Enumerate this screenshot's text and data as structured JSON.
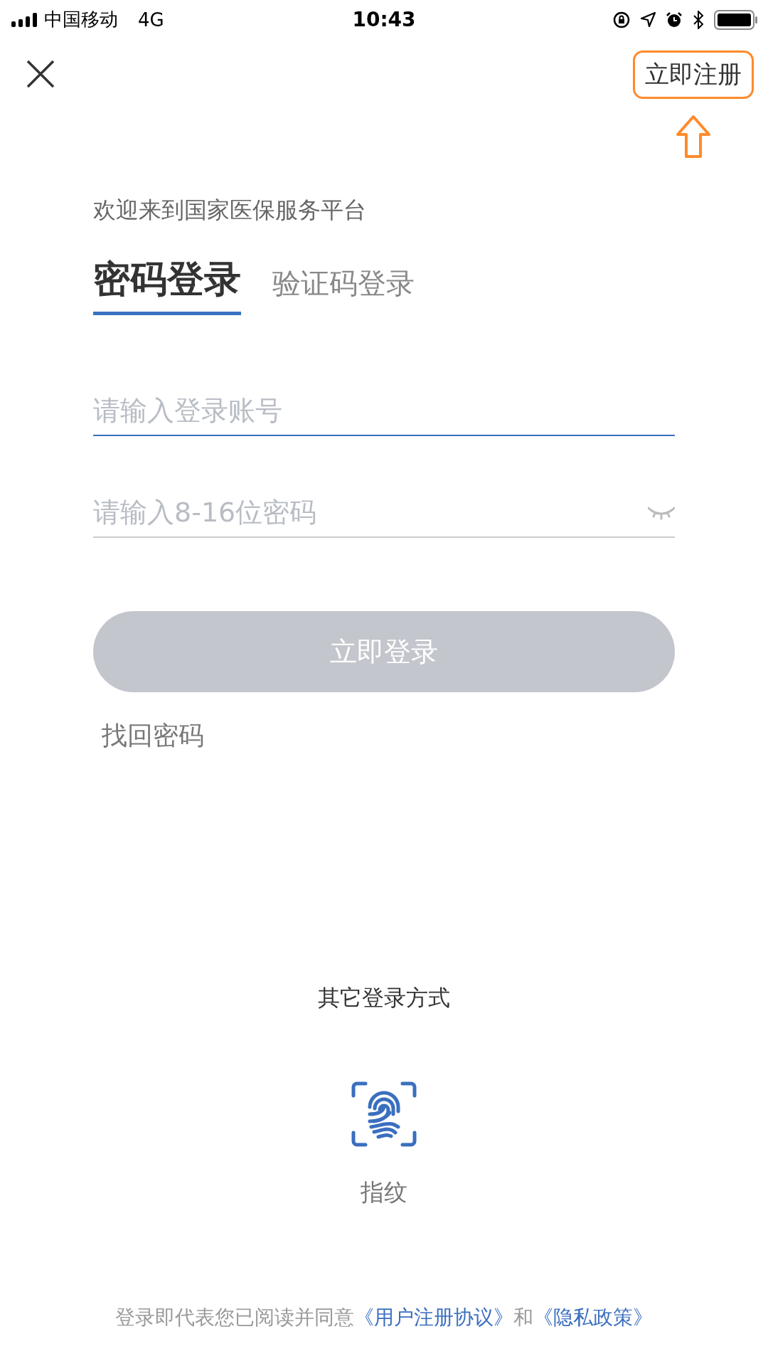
{
  "status_bar": {
    "carrier": "中国移动",
    "network": "4G",
    "time": "10:43"
  },
  "register_link": {
    "label": "立即注册",
    "highlighted": true
  },
  "welcome": "欢迎来到国家医保服务平台",
  "tabs": [
    {
      "label": "密码登录",
      "selected": true
    },
    {
      "label": "验证码登录",
      "selected": false
    }
  ],
  "fields": [
    {
      "kind": "account",
      "placeholder": "请输入登录账号",
      "focused": true
    },
    {
      "kind": "password",
      "placeholder": "请输入8-16位密码",
      "focused": false
    }
  ],
  "login_button": {
    "label": "立即登录",
    "disabled": true
  },
  "forgot_password": "找回密码",
  "other_login": {
    "title": "其它登录方式",
    "options": [
      {
        "kind": "fingerprint",
        "label": "指纹"
      }
    ]
  },
  "agreement": {
    "text": "登录即代表您已阅读并同意",
    "link1": "《用户注册协议》",
    "middle": "和",
    "link2": "《隐私政策》"
  }
}
